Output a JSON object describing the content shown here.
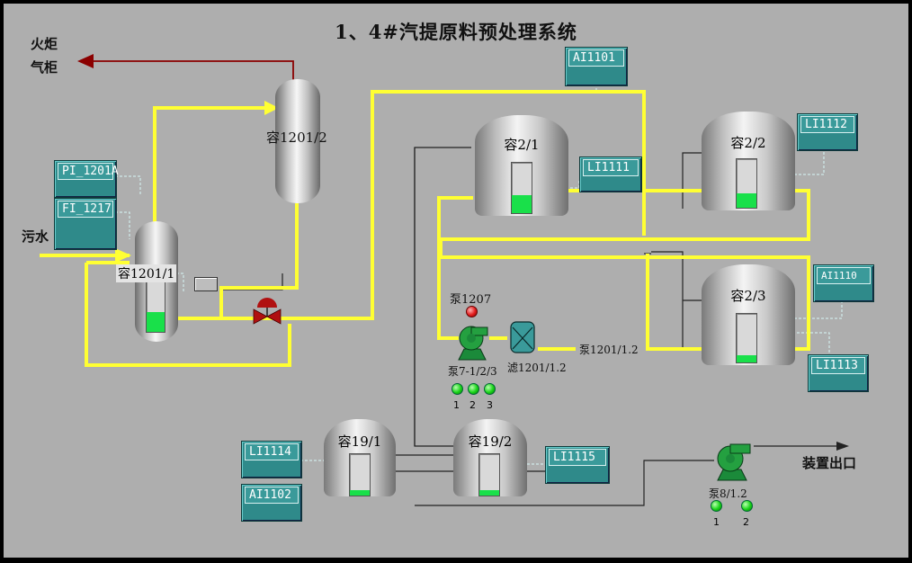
{
  "title": "1、4#汽提原料预处理系统",
  "labels": {
    "flare": "火炬",
    "gas_holder": "气柜",
    "sewage": "污水",
    "device_outlet": "装置出口"
  },
  "vessels": {
    "v1201_1": "容1201/1",
    "v1201_2": "容1201/2",
    "v2_1": "容2/1",
    "v2_2": "容2/2",
    "v2_3": "容2/3",
    "v19_1": "容19/1",
    "v19_2": "容19/2"
  },
  "levels": {
    "v1201_1": 0.4,
    "v2_1": 0.35,
    "v2_2": 0.3,
    "v2_3": 0.15,
    "v19_1": 0.12,
    "v19_2": 0.12
  },
  "tags": {
    "pi_1201a": "PI_1201A",
    "fi_1217": "FI_1217",
    "ai1101": "AI1101",
    "li1111": "LI1111",
    "li1112": "LI1112",
    "ai1110": "AI1110",
    "li1113": "LI1113",
    "li1114": "LI1114",
    "ai1102": "AI1102",
    "li1115": "LI1115"
  },
  "pumps": {
    "pump1207": "泵1207",
    "pump7": "泵7-1/2/3",
    "filter": "滤1201/1.2",
    "pump1201": "泵1201/1.2",
    "pump8": "泵8/1.2"
  },
  "led_numbers": {
    "p7_1": "1",
    "p7_2": "2",
    "p7_3": "3",
    "p8_1": "1",
    "p8_2": "2"
  },
  "colors": {
    "background": "#aeaeae",
    "pipe_main": "#ffff33",
    "pipe_vent": "#8b0000",
    "pipe_thin": "#222222",
    "level_fill": "#19e04a",
    "tag_bg": "#2f8a8a",
    "pump_green": "#1b8a3a",
    "valve_red": "#b01010"
  },
  "icons": {
    "vent_arrow": "arrow-left-icon",
    "outlet_arrow": "arrow-right-icon",
    "control_valve": "control-valve-icon",
    "pump": "pump-icon",
    "filter": "filter-icon"
  }
}
